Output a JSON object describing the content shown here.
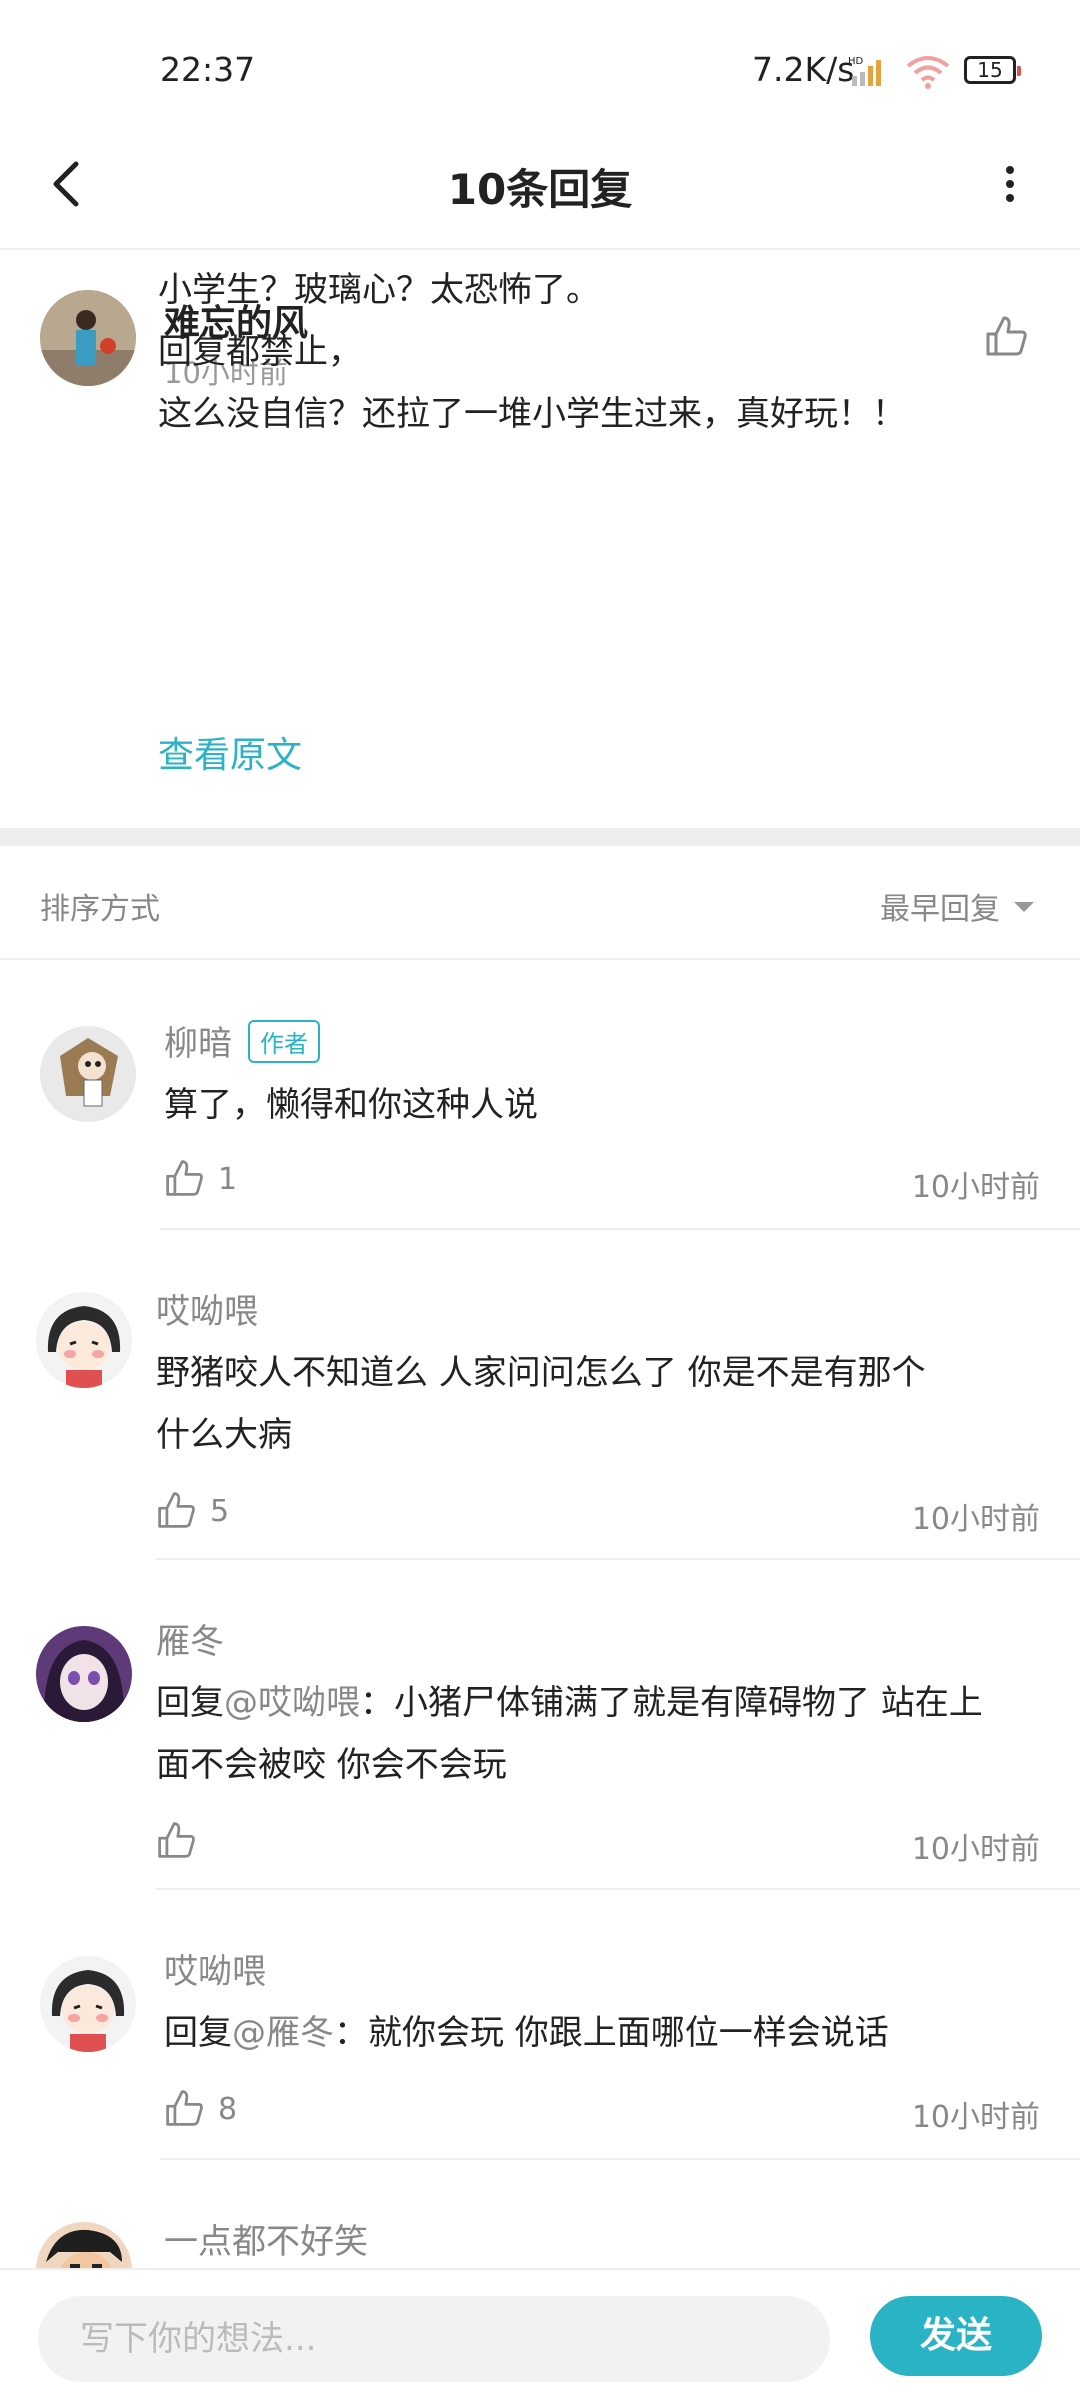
{
  "status_bar": {
    "time": "22:37",
    "net_speed": "7.2K/s",
    "signal_badge": "HD",
    "battery": "15"
  },
  "header": {
    "title": "10条回复",
    "back_icon": "chevron-left-icon",
    "more_icon": "more-vertical-icon"
  },
  "post": {
    "author": "难忘的风",
    "time": "10小时前",
    "lines": [
      "小学生？玻璃心？太恐怖了。",
      "回复都禁止，",
      "这么没自信？还拉了一堆小学生过来，真好玩！！"
    ],
    "view_original": "查看原文"
  },
  "sort": {
    "label": "排序方式",
    "value": "最早回复"
  },
  "replies": [
    {
      "name": "柳暗",
      "badge": "作者",
      "text": "算了，懒得和你这种人说",
      "likes": "1",
      "time": "10小时前"
    },
    {
      "name": "哎呦喂",
      "text_line1": "野猪咬人不知道么  人家问问怎么了  你是不是有那个",
      "text_line2": "什么大病",
      "likes": "5",
      "time": "10小时前"
    },
    {
      "name": "雁冬",
      "reply_prefix": "回复",
      "mention": "@哎呦喂",
      "text_line1": "：小猪尸体铺满了就是有障碍物了 站在上",
      "text_line2": "面不会被咬 你会不会玩",
      "likes": "",
      "time": "10小时前"
    },
    {
      "name": "哎呦喂",
      "reply_prefix": "回复",
      "mention": "@雁冬",
      "text_line1": "：就你会玩  你跟上面哪位一样会说话",
      "likes": "8",
      "time": "10小时前"
    },
    {
      "name": "一点都不好笑"
    }
  ],
  "input": {
    "placeholder": "写下你的想法...",
    "send_label": "发送"
  },
  "colors": {
    "accent": "#2ab3c4",
    "muted": "#888888",
    "divider": "#eeeeee"
  }
}
